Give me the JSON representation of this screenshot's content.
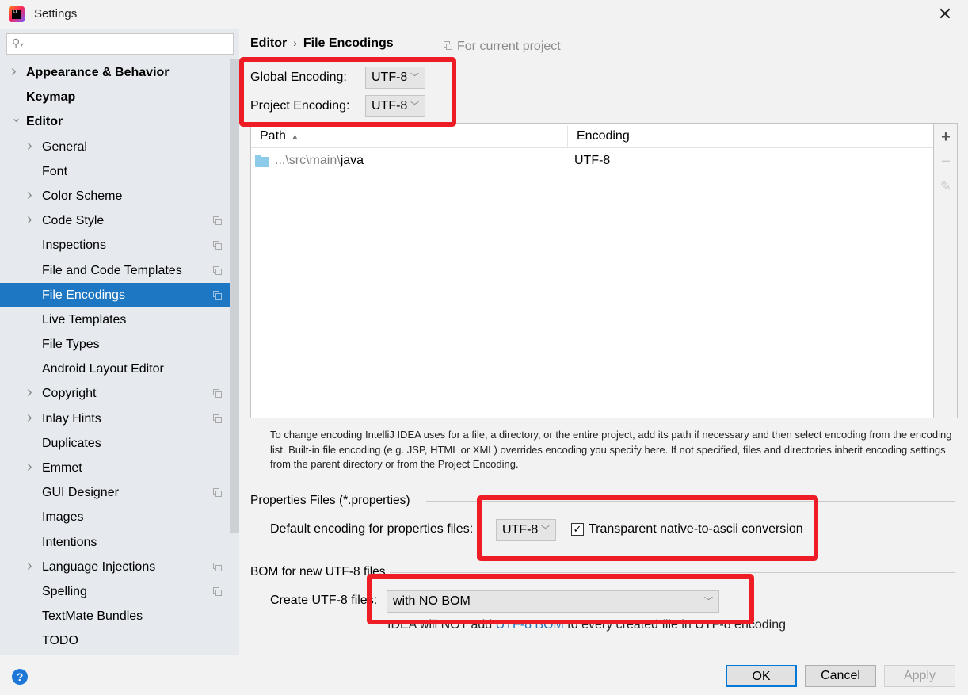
{
  "window": {
    "title": "Settings",
    "app_icon": "intellij-idea-icon",
    "close_icon": "close-icon"
  },
  "sidebar": {
    "search": {
      "placeholder": "",
      "value": ""
    },
    "items": [
      {
        "label": "Appearance & Behavior",
        "level": 0,
        "expandable": true,
        "expanded": false,
        "project_scoped": false,
        "selected": false
      },
      {
        "label": "Keymap",
        "level": 0,
        "expandable": false,
        "project_scoped": false,
        "selected": false
      },
      {
        "label": "Editor",
        "level": 0,
        "expandable": true,
        "expanded": true,
        "project_scoped": false,
        "selected": false
      },
      {
        "label": "General",
        "level": 1,
        "expandable": true,
        "expanded": false,
        "project_scoped": false,
        "selected": false
      },
      {
        "label": "Font",
        "level": 1,
        "expandable": false,
        "project_scoped": false,
        "selected": false
      },
      {
        "label": "Color Scheme",
        "level": 1,
        "expandable": true,
        "expanded": false,
        "project_scoped": false,
        "selected": false
      },
      {
        "label": "Code Style",
        "level": 1,
        "expandable": true,
        "expanded": false,
        "project_scoped": true,
        "selected": false
      },
      {
        "label": "Inspections",
        "level": 1,
        "expandable": false,
        "project_scoped": true,
        "selected": false
      },
      {
        "label": "File and Code Templates",
        "level": 1,
        "expandable": false,
        "project_scoped": true,
        "selected": false
      },
      {
        "label": "File Encodings",
        "level": 1,
        "expandable": false,
        "project_scoped": true,
        "selected": true
      },
      {
        "label": "Live Templates",
        "level": 1,
        "expandable": false,
        "project_scoped": false,
        "selected": false
      },
      {
        "label": "File Types",
        "level": 1,
        "expandable": false,
        "project_scoped": false,
        "selected": false
      },
      {
        "label": "Android Layout Editor",
        "level": 1,
        "expandable": false,
        "project_scoped": false,
        "selected": false
      },
      {
        "label": "Copyright",
        "level": 1,
        "expandable": true,
        "expanded": false,
        "project_scoped": true,
        "selected": false
      },
      {
        "label": "Inlay Hints",
        "level": 1,
        "expandable": true,
        "expanded": false,
        "project_scoped": true,
        "selected": false
      },
      {
        "label": "Duplicates",
        "level": 1,
        "expandable": false,
        "project_scoped": false,
        "selected": false
      },
      {
        "label": "Emmet",
        "level": 1,
        "expandable": true,
        "expanded": false,
        "project_scoped": false,
        "selected": false
      },
      {
        "label": "GUI Designer",
        "level": 1,
        "expandable": false,
        "project_scoped": true,
        "selected": false
      },
      {
        "label": "Images",
        "level": 1,
        "expandable": false,
        "project_scoped": false,
        "selected": false
      },
      {
        "label": "Intentions",
        "level": 1,
        "expandable": false,
        "project_scoped": false,
        "selected": false
      },
      {
        "label": "Language Injections",
        "level": 1,
        "expandable": true,
        "expanded": false,
        "project_scoped": true,
        "selected": false
      },
      {
        "label": "Spelling",
        "level": 1,
        "expandable": false,
        "project_scoped": true,
        "selected": false
      },
      {
        "label": "TextMate Bundles",
        "level": 1,
        "expandable": false,
        "project_scoped": false,
        "selected": false
      },
      {
        "label": "TODO",
        "level": 1,
        "expandable": false,
        "project_scoped": false,
        "selected": false
      }
    ]
  },
  "main": {
    "breadcrumb": {
      "parent": "Editor",
      "separator": "›",
      "current": "File Encodings"
    },
    "scope_note": "For current project",
    "global_encoding": {
      "label": "Global Encoding:",
      "value": "UTF-8"
    },
    "project_encoding": {
      "label": "Project Encoding:",
      "value": "UTF-8"
    },
    "table": {
      "columns": [
        {
          "label": "Path",
          "sort": "ascending"
        },
        {
          "label": "Encoding"
        }
      ],
      "rows": [
        {
          "path_prefix": "...\\src\\main\\",
          "path_name": "java",
          "encoding": "UTF-8"
        }
      ],
      "toolbar": {
        "add": "+",
        "remove": "−",
        "edit": "✎"
      }
    },
    "help_text": "To change encoding IntelliJ IDEA uses for a file, a directory, or the entire project, add its path if necessary and then select encoding from the encoding list. Built-in file encoding (e.g. JSP, HTML or XML) overrides encoding you specify here. If not specified, files and directories inherit encoding settings from the parent directory or from the Project Encoding.",
    "properties": {
      "group_title": "Properties Files (*.properties)",
      "default_label": "Default encoding for properties files:",
      "default_value": "UTF-8",
      "native_to_ascii": {
        "label": "Transparent native-to-ascii conversion",
        "checked": true
      }
    },
    "bom": {
      "group_title": "BOM for new UTF-8 files",
      "create_label": "Create UTF-8 files:",
      "create_value": "with NO BOM",
      "hint_before": "IDEA will NOT add ",
      "hint_link": "UTF-8 BOM",
      "hint_after": " to every created file in UTF-8 encoding"
    }
  },
  "footer": {
    "help": "?",
    "ok": "OK",
    "cancel": "Cancel",
    "apply": "Apply"
  },
  "annotations": {
    "highlight_color": "#ee1c25",
    "selection_color": "#1d77c3",
    "link_color": "#2470b3"
  }
}
